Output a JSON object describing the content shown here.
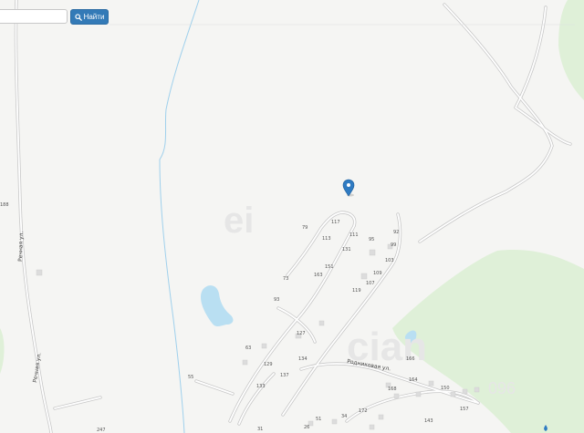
{
  "search": {
    "input_value": "",
    "input_placeholder": "",
    "button_label": "Найти",
    "button_icon": "search-icon"
  },
  "map": {
    "colors": {
      "background": "#f5f5f3",
      "forest": "#dff0d8",
      "water": "#b9dff2",
      "road_outline": "#c5c5c5",
      "road_fill": "#ffffff",
      "marker": "#2f7bc2"
    },
    "marker_icon": "map-pin-icon",
    "streets": {
      "rechnaya_1": "Речная ул.",
      "rechnaya_2": "Речная ул.",
      "rodnikovaya": "Родниковая ул."
    },
    "house_numbers": {
      "n188": "188",
      "n247": "247",
      "n55": "55",
      "n79": "79",
      "n117": "117",
      "n111": "111",
      "n113": "113",
      "n92": "92",
      "n95": "95",
      "n131": "131",
      "n99": "99",
      "n151": "151",
      "n163": "163",
      "n103": "103",
      "n109": "109",
      "n107": "107",
      "n73": "73",
      "n119": "119",
      "n93": "93",
      "n127": "127",
      "n63": "63",
      "n134": "134",
      "n129": "129",
      "n137": "137",
      "n133": "133",
      "n166": "166",
      "n164": "164",
      "n150": "150",
      "n157": "157",
      "n168": "168",
      "n172": "172",
      "n143": "143",
      "n26": "26",
      "n51": "51",
      "n34": "34",
      "n31": "31"
    },
    "watermark": {
      "big": "cian",
      "phone": "096"
    }
  }
}
